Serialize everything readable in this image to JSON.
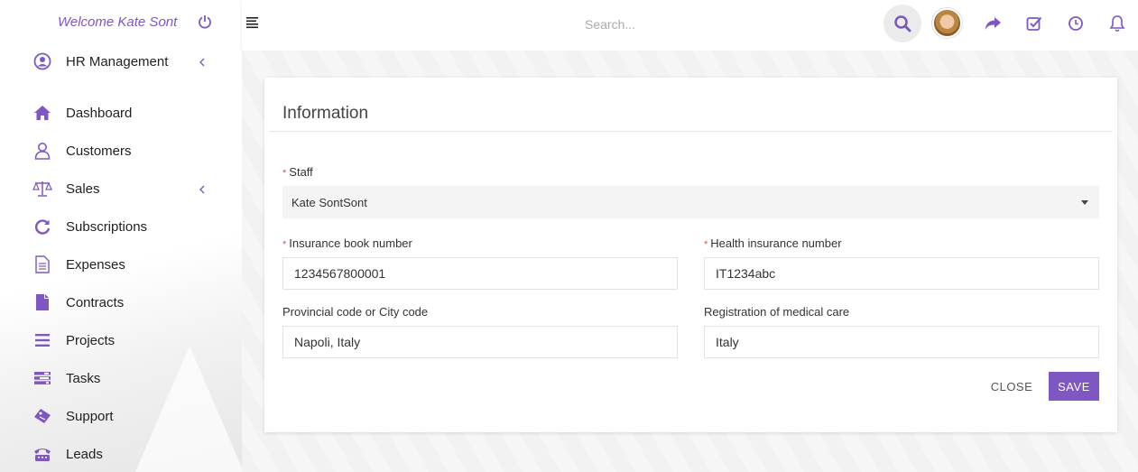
{
  "sidebar": {
    "welcome": "Welcome Kate Sont",
    "items": [
      {
        "label": "HR Management",
        "icon": "user-circle-icon"
      },
      {
        "label": "Dashboard",
        "icon": "home-icon"
      },
      {
        "label": "Customers",
        "icon": "user-icon"
      },
      {
        "label": "Sales",
        "icon": "scale-icon"
      },
      {
        "label": "Subscriptions",
        "icon": "refresh-icon"
      },
      {
        "label": "Expenses",
        "icon": "file-text-icon"
      },
      {
        "label": "Contracts",
        "icon": "file-icon"
      },
      {
        "label": "Projects",
        "icon": "bars-icon"
      },
      {
        "label": "Tasks",
        "icon": "tasks-icon"
      },
      {
        "label": "Support",
        "icon": "ticket-icon"
      },
      {
        "label": "Leads",
        "icon": "tty-icon"
      }
    ]
  },
  "header": {
    "search_placeholder": "Search..."
  },
  "form": {
    "title": "Information",
    "staff_label": "Staff",
    "staff_value": "Kate SontSont",
    "insurance_label": "Insurance book number",
    "insurance_value": "1234567800001",
    "health_label": "Health insurance number",
    "health_value": "IT1234abc",
    "provincial_label": "Provincial code or City code",
    "provincial_value": "Napoli, Italy",
    "medical_label": "Registration of medical care",
    "medical_value": "Italy",
    "close_label": "CLOSE",
    "save_label": "SAVE"
  },
  "colors": {
    "accent": "#7e57c2",
    "required": "#e05252"
  }
}
